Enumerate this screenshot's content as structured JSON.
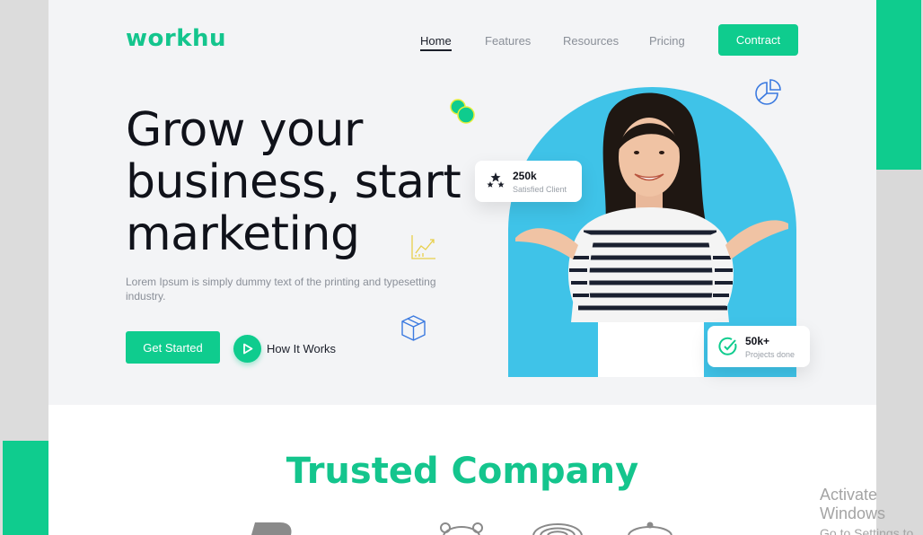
{
  "brand": {
    "name": "workhu",
    "accent": "#0fcc8e"
  },
  "nav": {
    "items": [
      {
        "label": "Home",
        "active": true
      },
      {
        "label": "Features"
      },
      {
        "label": "Resources"
      },
      {
        "label": "Pricing"
      }
    ],
    "cta_label": "Contract"
  },
  "hero": {
    "headline": "Grow your business, start marketing",
    "subtext": "Lorem Ipsum is simply dummy text of the printing and typesetting industry.",
    "primary_button": "Get Started",
    "secondary_button": "How It Works",
    "stats": [
      {
        "value": "250k",
        "label": "Satisfied Client",
        "icon": "stars-icon"
      },
      {
        "value": "50k+",
        "label": "Projects done",
        "icon": "check-circle-icon"
      }
    ],
    "photo_background": "#3fc3e8"
  },
  "trusted": {
    "title": "Trusted Company"
  },
  "windows_watermark": {
    "title": "Activate Windows",
    "subtitle": "Go to Settings to activate Windows."
  }
}
